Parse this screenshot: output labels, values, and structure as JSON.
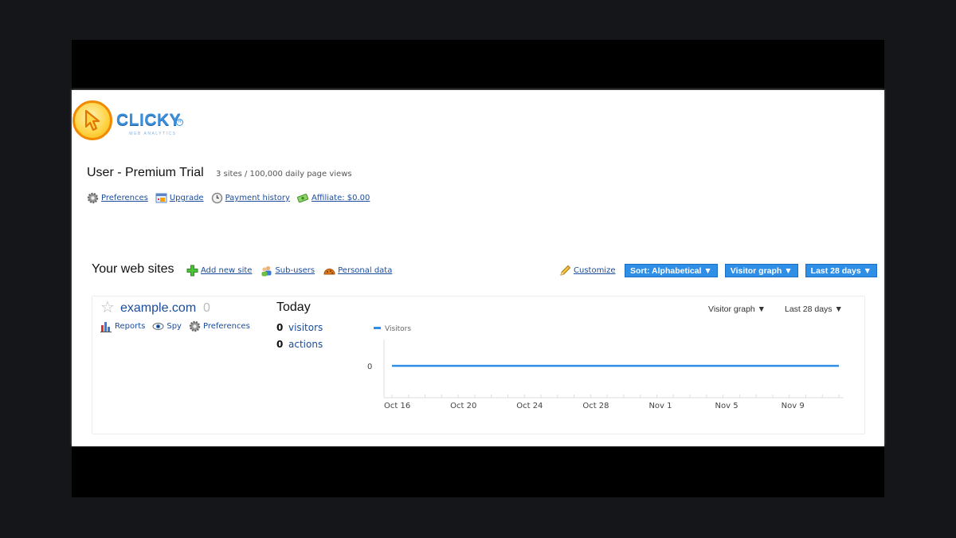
{
  "logo": {
    "wordmark": "CLICKY",
    "registered": "R",
    "tagline": "WEB ANALYTICS"
  },
  "account": {
    "title": "User - Premium Trial",
    "meta": "3 sites / 100,000 daily page views",
    "links": [
      {
        "label": "Preferences",
        "icon": "gear-icon"
      },
      {
        "label": "Upgrade",
        "icon": "upgrade-icon"
      },
      {
        "label": "Payment history",
        "icon": "clock-icon"
      },
      {
        "label": "Affiliate: $0.00",
        "icon": "money-icon"
      }
    ]
  },
  "websites": {
    "title": "Your web sites",
    "links": [
      {
        "label": "Add new site",
        "icon": "plus-icon"
      },
      {
        "label": "Sub-users",
        "icon": "users-icon"
      },
      {
        "label": "Personal data",
        "icon": "cookie-icon"
      }
    ],
    "customize_label": "Customize",
    "sort_button": "Sort: Alphabetical ▼",
    "graph_button": "Visitor graph ▼",
    "range_button": "Last 28 days ▼"
  },
  "site": {
    "name": "example.com",
    "count": "0",
    "links": [
      {
        "label": "Reports",
        "icon": "bar-chart-icon"
      },
      {
        "label": "Spy",
        "icon": "eye-icon"
      },
      {
        "label": "Preferences",
        "icon": "gear-icon"
      }
    ],
    "today_label": "Today",
    "visitors_value": "0",
    "visitors_label": "visitors",
    "actions_value": "0",
    "actions_label": "actions",
    "graph_dropdown": "Visitor graph ▼",
    "range_dropdown": "Last 28 days ▼"
  },
  "chart_data": {
    "type": "line",
    "series": [
      {
        "name": "Visitors",
        "values": [
          0,
          0,
          0,
          0,
          0,
          0,
          0,
          0,
          0,
          0,
          0,
          0,
          0,
          0,
          0,
          0,
          0,
          0,
          0,
          0,
          0,
          0,
          0,
          0,
          0,
          0,
          0,
          0
        ]
      }
    ],
    "x": [
      "Oct 16",
      "Oct 17",
      "Oct 18",
      "Oct 19",
      "Oct 20",
      "Oct 21",
      "Oct 22",
      "Oct 23",
      "Oct 24",
      "Oct 25",
      "Oct 26",
      "Oct 27",
      "Oct 28",
      "Oct 29",
      "Oct 30",
      "Oct 31",
      "Nov 1",
      "Nov 2",
      "Nov 3",
      "Nov 4",
      "Nov 5",
      "Nov 6",
      "Nov 7",
      "Nov 8",
      "Nov 9",
      "Nov 10",
      "Nov 11",
      "Nov 12"
    ],
    "tick_labels": [
      "Oct 16",
      "Oct 20",
      "Oct 24",
      "Oct 28",
      "Nov 1",
      "Nov 5",
      "Nov 9"
    ],
    "y_ticks": [
      "0"
    ],
    "line_color": "#2f8fe6",
    "legend_position": "top-left"
  }
}
